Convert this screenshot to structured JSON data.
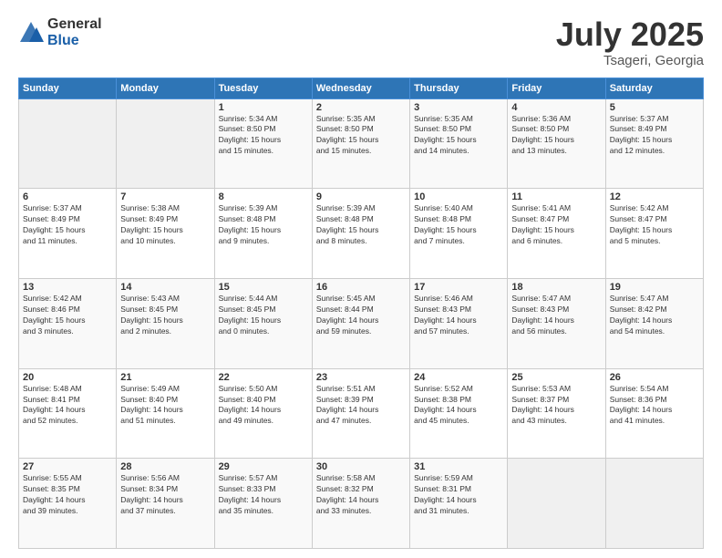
{
  "logo": {
    "general": "General",
    "blue": "Blue"
  },
  "header": {
    "month": "July 2025",
    "location": "Tsageri, Georgia"
  },
  "weekdays": [
    "Sunday",
    "Monday",
    "Tuesday",
    "Wednesday",
    "Thursday",
    "Friday",
    "Saturday"
  ],
  "weeks": [
    [
      {
        "day": "",
        "info": ""
      },
      {
        "day": "",
        "info": ""
      },
      {
        "day": "1",
        "info": "Sunrise: 5:34 AM\nSunset: 8:50 PM\nDaylight: 15 hours\nand 15 minutes."
      },
      {
        "day": "2",
        "info": "Sunrise: 5:35 AM\nSunset: 8:50 PM\nDaylight: 15 hours\nand 15 minutes."
      },
      {
        "day": "3",
        "info": "Sunrise: 5:35 AM\nSunset: 8:50 PM\nDaylight: 15 hours\nand 14 minutes."
      },
      {
        "day": "4",
        "info": "Sunrise: 5:36 AM\nSunset: 8:50 PM\nDaylight: 15 hours\nand 13 minutes."
      },
      {
        "day": "5",
        "info": "Sunrise: 5:37 AM\nSunset: 8:49 PM\nDaylight: 15 hours\nand 12 minutes."
      }
    ],
    [
      {
        "day": "6",
        "info": "Sunrise: 5:37 AM\nSunset: 8:49 PM\nDaylight: 15 hours\nand 11 minutes."
      },
      {
        "day": "7",
        "info": "Sunrise: 5:38 AM\nSunset: 8:49 PM\nDaylight: 15 hours\nand 10 minutes."
      },
      {
        "day": "8",
        "info": "Sunrise: 5:39 AM\nSunset: 8:48 PM\nDaylight: 15 hours\nand 9 minutes."
      },
      {
        "day": "9",
        "info": "Sunrise: 5:39 AM\nSunset: 8:48 PM\nDaylight: 15 hours\nand 8 minutes."
      },
      {
        "day": "10",
        "info": "Sunrise: 5:40 AM\nSunset: 8:48 PM\nDaylight: 15 hours\nand 7 minutes."
      },
      {
        "day": "11",
        "info": "Sunrise: 5:41 AM\nSunset: 8:47 PM\nDaylight: 15 hours\nand 6 minutes."
      },
      {
        "day": "12",
        "info": "Sunrise: 5:42 AM\nSunset: 8:47 PM\nDaylight: 15 hours\nand 5 minutes."
      }
    ],
    [
      {
        "day": "13",
        "info": "Sunrise: 5:42 AM\nSunset: 8:46 PM\nDaylight: 15 hours\nand 3 minutes."
      },
      {
        "day": "14",
        "info": "Sunrise: 5:43 AM\nSunset: 8:45 PM\nDaylight: 15 hours\nand 2 minutes."
      },
      {
        "day": "15",
        "info": "Sunrise: 5:44 AM\nSunset: 8:45 PM\nDaylight: 15 hours\nand 0 minutes."
      },
      {
        "day": "16",
        "info": "Sunrise: 5:45 AM\nSunset: 8:44 PM\nDaylight: 14 hours\nand 59 minutes."
      },
      {
        "day": "17",
        "info": "Sunrise: 5:46 AM\nSunset: 8:43 PM\nDaylight: 14 hours\nand 57 minutes."
      },
      {
        "day": "18",
        "info": "Sunrise: 5:47 AM\nSunset: 8:43 PM\nDaylight: 14 hours\nand 56 minutes."
      },
      {
        "day": "19",
        "info": "Sunrise: 5:47 AM\nSunset: 8:42 PM\nDaylight: 14 hours\nand 54 minutes."
      }
    ],
    [
      {
        "day": "20",
        "info": "Sunrise: 5:48 AM\nSunset: 8:41 PM\nDaylight: 14 hours\nand 52 minutes."
      },
      {
        "day": "21",
        "info": "Sunrise: 5:49 AM\nSunset: 8:40 PM\nDaylight: 14 hours\nand 51 minutes."
      },
      {
        "day": "22",
        "info": "Sunrise: 5:50 AM\nSunset: 8:40 PM\nDaylight: 14 hours\nand 49 minutes."
      },
      {
        "day": "23",
        "info": "Sunrise: 5:51 AM\nSunset: 8:39 PM\nDaylight: 14 hours\nand 47 minutes."
      },
      {
        "day": "24",
        "info": "Sunrise: 5:52 AM\nSunset: 8:38 PM\nDaylight: 14 hours\nand 45 minutes."
      },
      {
        "day": "25",
        "info": "Sunrise: 5:53 AM\nSunset: 8:37 PM\nDaylight: 14 hours\nand 43 minutes."
      },
      {
        "day": "26",
        "info": "Sunrise: 5:54 AM\nSunset: 8:36 PM\nDaylight: 14 hours\nand 41 minutes."
      }
    ],
    [
      {
        "day": "27",
        "info": "Sunrise: 5:55 AM\nSunset: 8:35 PM\nDaylight: 14 hours\nand 39 minutes."
      },
      {
        "day": "28",
        "info": "Sunrise: 5:56 AM\nSunset: 8:34 PM\nDaylight: 14 hours\nand 37 minutes."
      },
      {
        "day": "29",
        "info": "Sunrise: 5:57 AM\nSunset: 8:33 PM\nDaylight: 14 hours\nand 35 minutes."
      },
      {
        "day": "30",
        "info": "Sunrise: 5:58 AM\nSunset: 8:32 PM\nDaylight: 14 hours\nand 33 minutes."
      },
      {
        "day": "31",
        "info": "Sunrise: 5:59 AM\nSunset: 8:31 PM\nDaylight: 14 hours\nand 31 minutes."
      },
      {
        "day": "",
        "info": ""
      },
      {
        "day": "",
        "info": ""
      }
    ]
  ]
}
